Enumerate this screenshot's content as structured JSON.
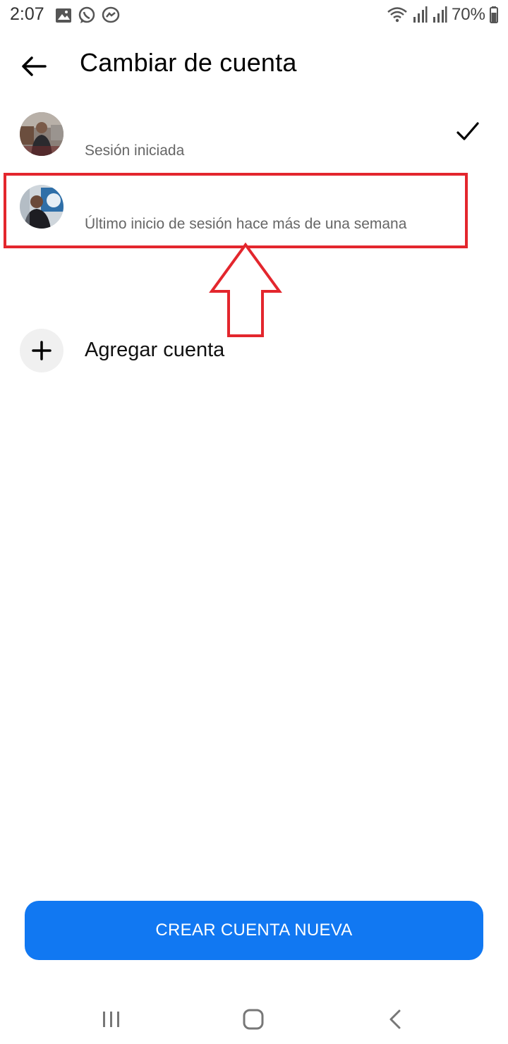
{
  "status": {
    "time": "2:07",
    "battery": "70%",
    "icons_left": [
      "image-icon",
      "whatsapp-icon",
      "messenger-icon"
    ],
    "icons_right": [
      "wifi-icon",
      "signal-icon",
      "signal-icon",
      "battery-icon"
    ]
  },
  "header": {
    "title": "Cambiar de cuenta"
  },
  "accounts": [
    {
      "name": "",
      "status": "Sesión iniciada",
      "selected": true
    },
    {
      "name": "",
      "status": "Último inicio de sesión hace más de una semana",
      "selected": false
    }
  ],
  "add_account": {
    "label": "Agregar cuenta"
  },
  "create_button": {
    "label": "CREAR CUENTA NUEVA"
  },
  "colors": {
    "accent": "#1178f2",
    "annotation": "#e3262d"
  }
}
